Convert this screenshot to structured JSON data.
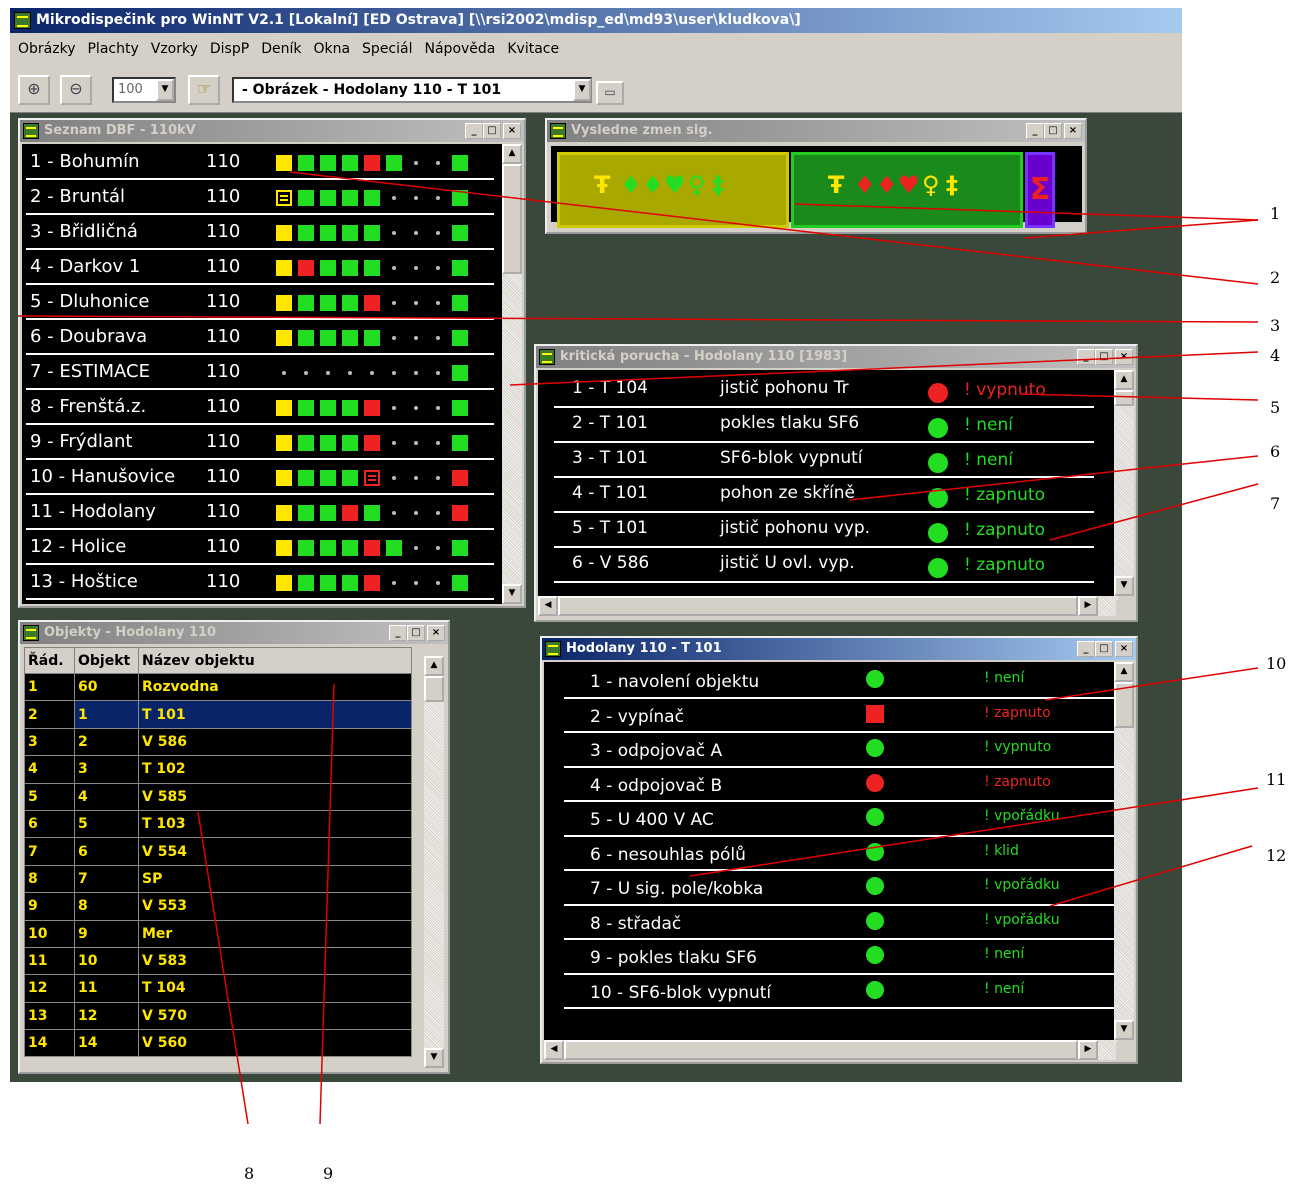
{
  "app": {
    "title": "Mikrodispečink pro WinNT V2.1  [Lokalní] [ED Ostrava] [\\\\rsi2002\\mdisp_ed\\md93\\user\\kludkova\\]"
  },
  "menu": [
    "Obrázky",
    "Plachty",
    "Vzorky",
    "DispP",
    "Deník",
    "Okna",
    "Speciál",
    "Nápověda",
    "Kvitace"
  ],
  "toolbar": {
    "zoom": "100",
    "picture": "- Obrázek - Hodolany   110 - T 101"
  },
  "win_dbf": {
    "title": "Seznam DBF - 110kV",
    "rows": [
      {
        "label": "1 - Bohumín",
        "kv": "110",
        "lamps": "Y G G G R G . . G"
      },
      {
        "label": "2 - Bruntál",
        "kv": "110",
        "lamps": "F G G G G . . . G"
      },
      {
        "label": "3 - Břidličná",
        "kv": "110",
        "lamps": "Y G G G G . . . G"
      },
      {
        "label": "4 - Darkov 1",
        "kv": "110",
        "lamps": "Y R G G G . . . G"
      },
      {
        "label": "5 - Dluhonice",
        "kv": "110",
        "lamps": "Y G G G R . . . G"
      },
      {
        "label": "6 - Doubrava",
        "kv": "110",
        "lamps": "Y G G G G . . . G"
      },
      {
        "label": "7 - ESTIMACE",
        "kv": "110",
        "lamps": ". . . . . . . . G"
      },
      {
        "label": "8 - Frenštá.z.",
        "kv": "110",
        "lamps": "Y G G G R . . . G"
      },
      {
        "label": "9 - Frýdlant",
        "kv": "110",
        "lamps": "Y G G G R . . . G"
      },
      {
        "label": "10 - Hanušovice",
        "kv": "110",
        "lamps": "Y G G G E . . . R"
      },
      {
        "label": "11 - Hodolany",
        "kv": "110",
        "lamps": "Y G G R G . . . R"
      },
      {
        "label": "12 - Holice",
        "kv": "110",
        "lamps": "Y G G G R G . . G"
      },
      {
        "label": "13 - Hoštice",
        "kv": "110",
        "lamps": "Y G G G R . . . G"
      }
    ]
  },
  "win_res": {
    "title": "Vysledne zmen sig."
  },
  "win_crit": {
    "title": "kritická porucha  - Hodolany  110 [1983]",
    "rows": [
      {
        "obj": "1 - T 104",
        "desc": "jistič pohonu Tr",
        "lamp": "red",
        "state": "! vypnuto"
      },
      {
        "obj": "2 - T 101",
        "desc": "pokles tlaku SF6",
        "lamp": "green",
        "state": "! není"
      },
      {
        "obj": "3 - T 101",
        "desc": "SF6-blok vypnutí",
        "lamp": "green",
        "state": "! není"
      },
      {
        "obj": "4 - T 101",
        "desc": "pohon ze skříně",
        "lamp": "green",
        "state": "! zapnuto"
      },
      {
        "obj": "5 - T 101",
        "desc": "jistič pohonu vyp.",
        "lamp": "green",
        "state": "! zapnuto"
      },
      {
        "obj": "6 - V 586",
        "desc": "jistič U ovl. vyp.",
        "lamp": "green",
        "state": "! zapnuto"
      }
    ]
  },
  "win_obj": {
    "title": "Objekty - Hodolany  110",
    "headers": [
      "Řád.",
      "Objekt",
      "Název objektu"
    ],
    "rows": [
      [
        "1",
        "60",
        "Rozvodna"
      ],
      [
        "2",
        "1",
        "T 101"
      ],
      [
        "3",
        "2",
        "V 586"
      ],
      [
        "4",
        "3",
        "T 102"
      ],
      [
        "5",
        "4",
        "V 585"
      ],
      [
        "6",
        "5",
        "T 103"
      ],
      [
        "7",
        "6",
        "V 554"
      ],
      [
        "8",
        "7",
        "SP"
      ],
      [
        "9",
        "8",
        "V 553"
      ],
      [
        "10",
        "9",
        "Mer"
      ],
      [
        "11",
        "10",
        "V 583"
      ],
      [
        "12",
        "11",
        "T 104"
      ],
      [
        "13",
        "12",
        "V 570"
      ],
      [
        "14",
        "14",
        "V 560"
      ]
    ]
  },
  "win_t101": {
    "title": "Hodolany   110 - T 101",
    "rows": [
      {
        "label": "1 - navolení objektu",
        "ind": "circle-green",
        "state": "! není"
      },
      {
        "label": "2 - vypínač",
        "ind": "square-red",
        "state": "! zapnuto"
      },
      {
        "label": "3 - odpojovač A",
        "ind": "circle-green",
        "state": "! vypnuto"
      },
      {
        "label": "4 - odpojovač B",
        "ind": "circle-red",
        "state": "! zapnuto"
      },
      {
        "label": "5 - U 400 V AC",
        "ind": "circle-green",
        "state": "! vpořádku"
      },
      {
        "label": "6 - nesouhlas pólů",
        "ind": "circle-green",
        "state": "! klid"
      },
      {
        "label": "7 - U sig. pole/kobka",
        "ind": "circle-green",
        "state": "! vpořádku"
      },
      {
        "label": "8 - střadač",
        "ind": "circle-green",
        "state": "! vpořádku"
      },
      {
        "label": "9 - pokles tlaku SF6",
        "ind": "circle-green",
        "state": "! není"
      },
      {
        "label": "10 - SF6-blok vypnutí",
        "ind": "circle-green",
        "state": "! není"
      }
    ]
  },
  "callouts": [
    "1",
    "2",
    "3",
    "4",
    "5",
    "6",
    "7",
    "8",
    "9",
    "10",
    "11",
    "12"
  ],
  "colors": {
    "workspace": "#39483b",
    "lamp_green": "#22dd22",
    "lamp_red": "#ee2222",
    "lamp_yellow": "#ffe600",
    "callout_line": "#e00000"
  }
}
